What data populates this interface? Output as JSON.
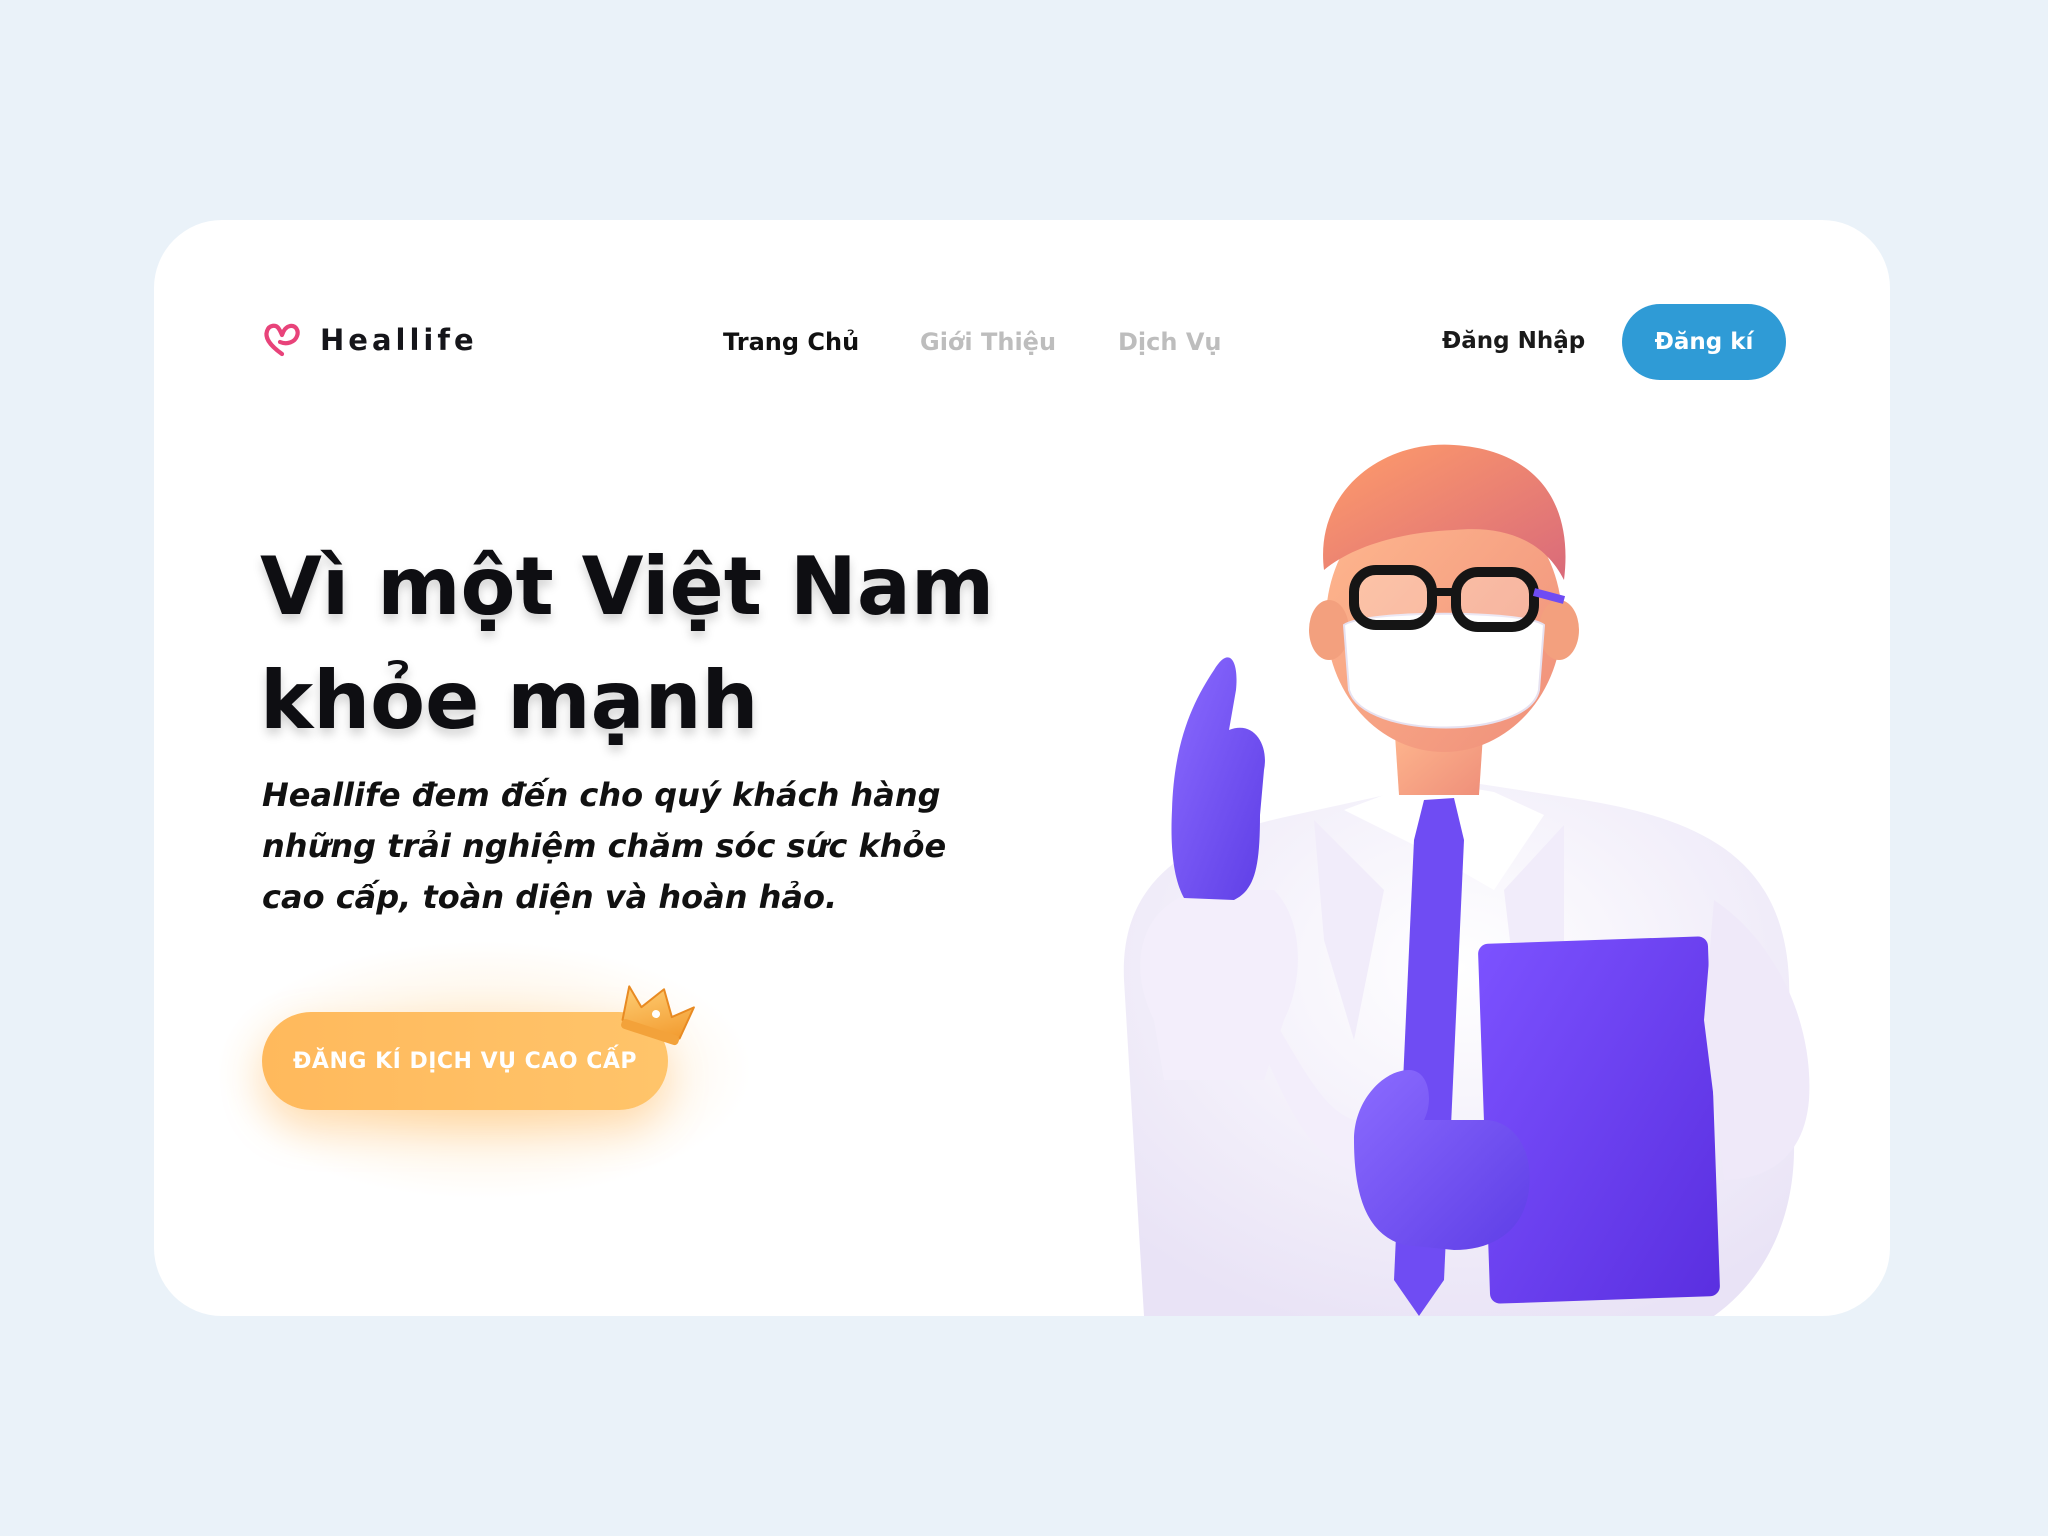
{
  "brand": {
    "name": "Heallife",
    "logo_icon": "heart-icon",
    "accent": "#e8437a"
  },
  "nav": {
    "items": [
      {
        "label": "Trang Chủ",
        "active": true
      },
      {
        "label": "Giới Thiệu",
        "active": false
      },
      {
        "label": "Dịch Vụ",
        "active": false
      }
    ]
  },
  "auth": {
    "login_label": "Đăng Nhập",
    "signup_label": "Đăng kí",
    "signup_color": "#2f9bd6"
  },
  "hero": {
    "title_lines": [
      "Vì một Việt Nam",
      "khỏe mạnh"
    ],
    "subtitle_lines": [
      "Heallife đem đến cho quý khách hàng",
      "những trải nghiệm chăm sóc sức khỏe",
      "cao cấp, toàn diện và hoàn hảo."
    ],
    "cta_label": "ĐĂNG KÍ DỊCH VỤ CAO CẤP",
    "cta_icon": "crown-icon",
    "cta_color": "#ffbb5f"
  },
  "illustration": {
    "name": "doctor-illustration"
  },
  "colors": {
    "page_bg": "#eaf2f9",
    "card_bg": "#ffffff",
    "text": "#111111",
    "muted": "#bdbdbd"
  }
}
